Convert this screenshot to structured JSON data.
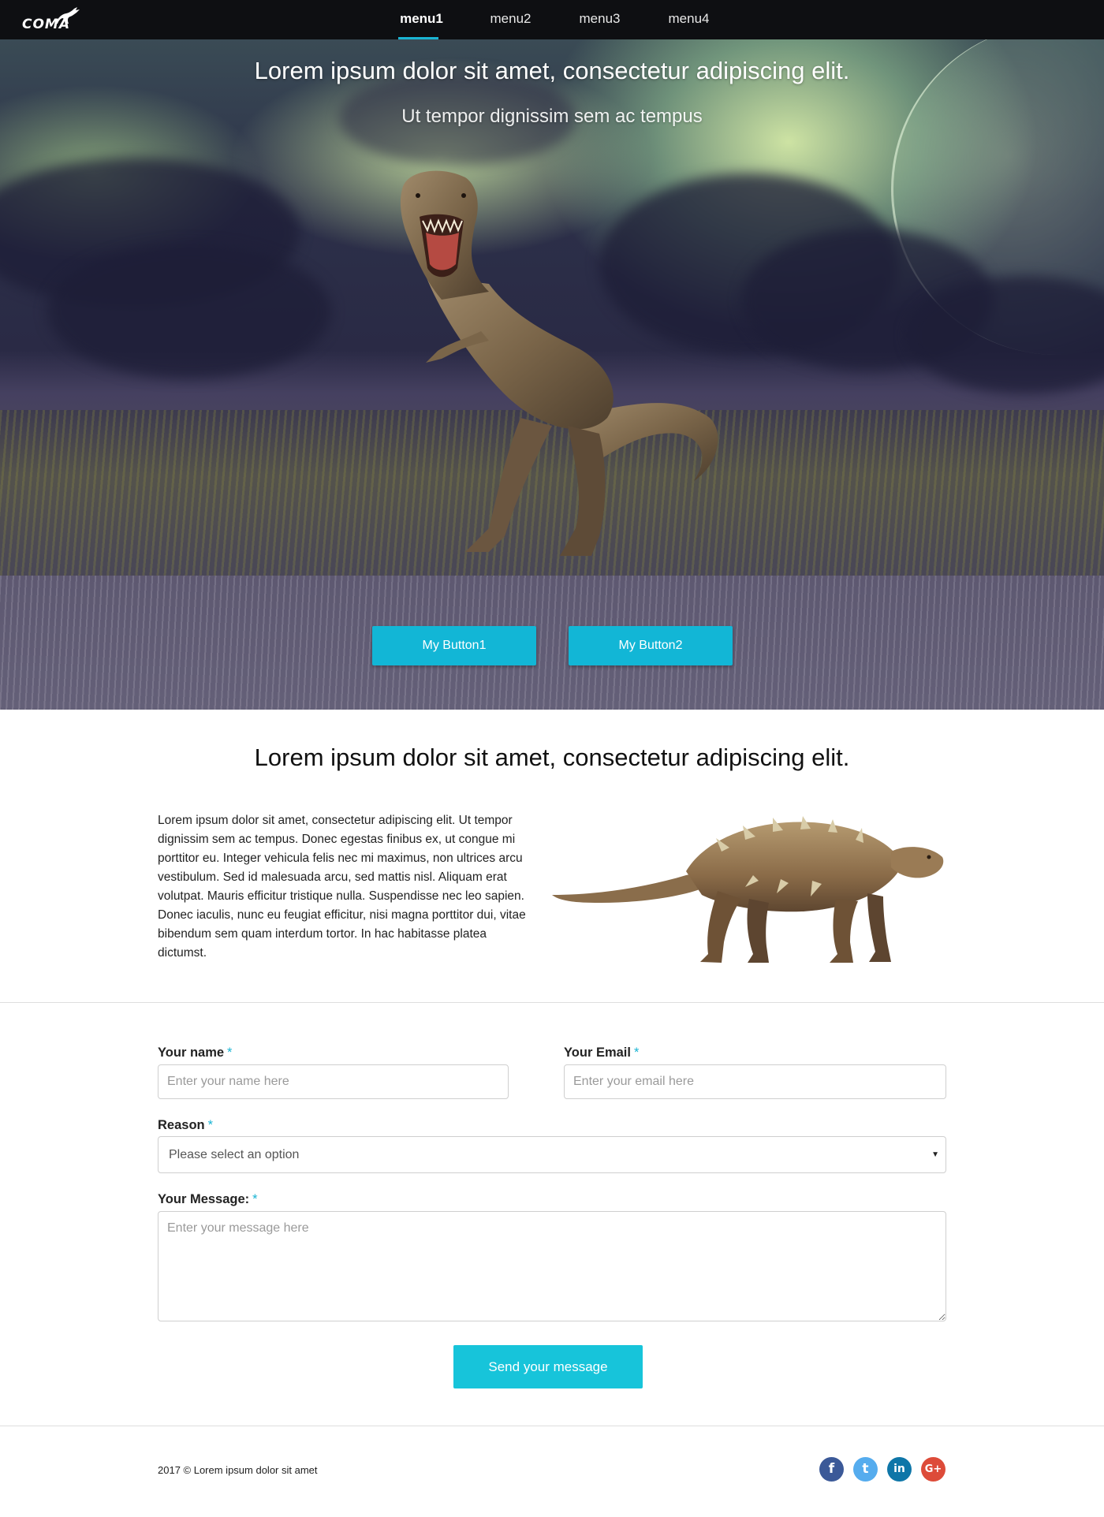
{
  "nav": {
    "logo_text": "COMA",
    "items": [
      {
        "label": "menu1",
        "active": true
      },
      {
        "label": "menu2",
        "active": false
      },
      {
        "label": "menu3",
        "active": false
      },
      {
        "label": "menu4",
        "active": false
      }
    ],
    "accent_color": "#1ab4d3"
  },
  "hero": {
    "title": "Lorem ipsum dolor sit amet, consectetur adipiscing elit.",
    "subtitle": "Ut tempor dignissim sem ac tempus",
    "button1_label": "My Button1",
    "button2_label": "My Button2",
    "button_color": "#12b6d6",
    "image_icon": "t-rex-illustration"
  },
  "about": {
    "title": "Lorem ipsum dolor sit amet, consectetur adipiscing elit.",
    "text": "Lorem ipsum dolor sit amet, consectetur adipiscing elit. Ut tempor dignissim sem ac tempus. Donec egestas finibus ex, ut congue mi porttitor eu. Integer vehicula felis nec mi maximus, non ultrices arcu vestibulum. Sed id malesuada arcu, sed mattis nisl. Aliquam erat volutpat. Mauris efficitur tristique nulla. Suspendisse nec leo sapien. Donec iaculis, nunc eu feugiat efficitur, nisi magna porttitor dui, vitae bibendum sem quam interdum tortor. In hac habitasse platea dictumst.",
    "image_icon": "ankylosaurus-illustration"
  },
  "form": {
    "name_label": "Your name",
    "name_placeholder": "Enter your name here",
    "email_label": "Your Email",
    "email_placeholder": "Enter your email here",
    "reason_label": "Reason",
    "reason_selected": "Please select an option",
    "message_label": "Your Message:",
    "message_placeholder": "Enter your message here",
    "required_marker": "*",
    "submit_label": "Send your message",
    "submit_color": "#17c4da"
  },
  "footer": {
    "copyright": "2017 © Lorem ipsum dolor sit amet",
    "social": [
      {
        "name": "facebook-icon",
        "glyph": "f",
        "color": "#3b5998"
      },
      {
        "name": "twitter-icon",
        "glyph": "t",
        "color": "#55acee"
      },
      {
        "name": "linkedin-icon",
        "glyph": "in",
        "color": "#0e76a8"
      },
      {
        "name": "google-plus-icon",
        "glyph": "G+",
        "color": "#dd4b39"
      }
    ]
  }
}
